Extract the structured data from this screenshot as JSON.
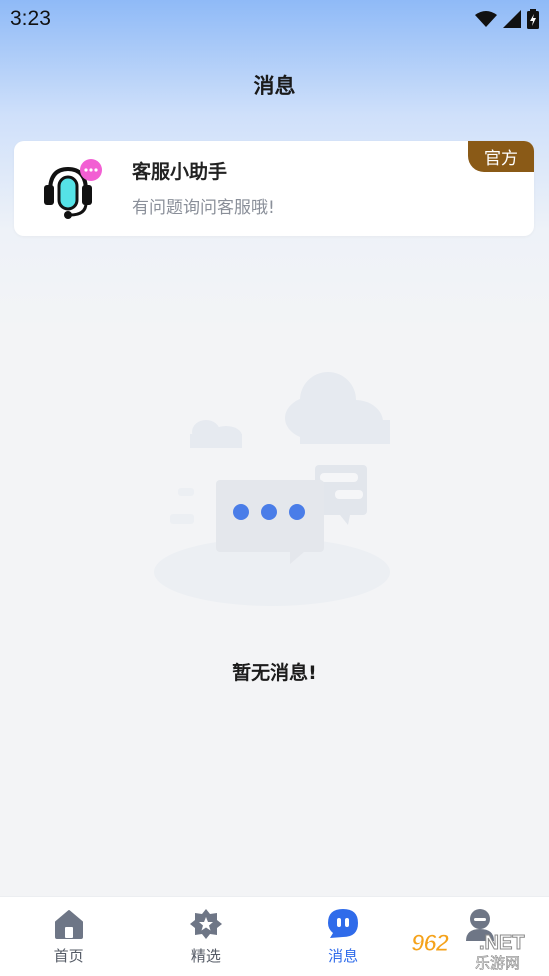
{
  "status_bar": {
    "time": "3:23"
  },
  "page_title": "消息",
  "message_card": {
    "name": "客服小助手",
    "subtitle": "有问题询问客服哦!",
    "badge": "官方",
    "avatar_icon": "headset-chat-icon"
  },
  "empty_state": {
    "text": "暂无消息!",
    "illustration": "chat-bubble-clouds-illustration"
  },
  "tabbar": {
    "items": [
      {
        "label": "首页",
        "icon": "home-icon",
        "active": false
      },
      {
        "label": "精选",
        "icon": "star-gear-icon",
        "active": false
      },
      {
        "label": "消息",
        "icon": "message-icon",
        "active": true
      },
      {
        "label": "",
        "icon": "profile-icon",
        "active": false
      }
    ]
  },
  "watermark": {
    "number": "962",
    "suffix": ".NET",
    "chinese": "乐游网"
  },
  "colors": {
    "accent": "#2f6bea",
    "badge": "#8a5a17",
    "avatar_pink": "#f25fd3",
    "avatar_teal": "#55e2e6"
  }
}
